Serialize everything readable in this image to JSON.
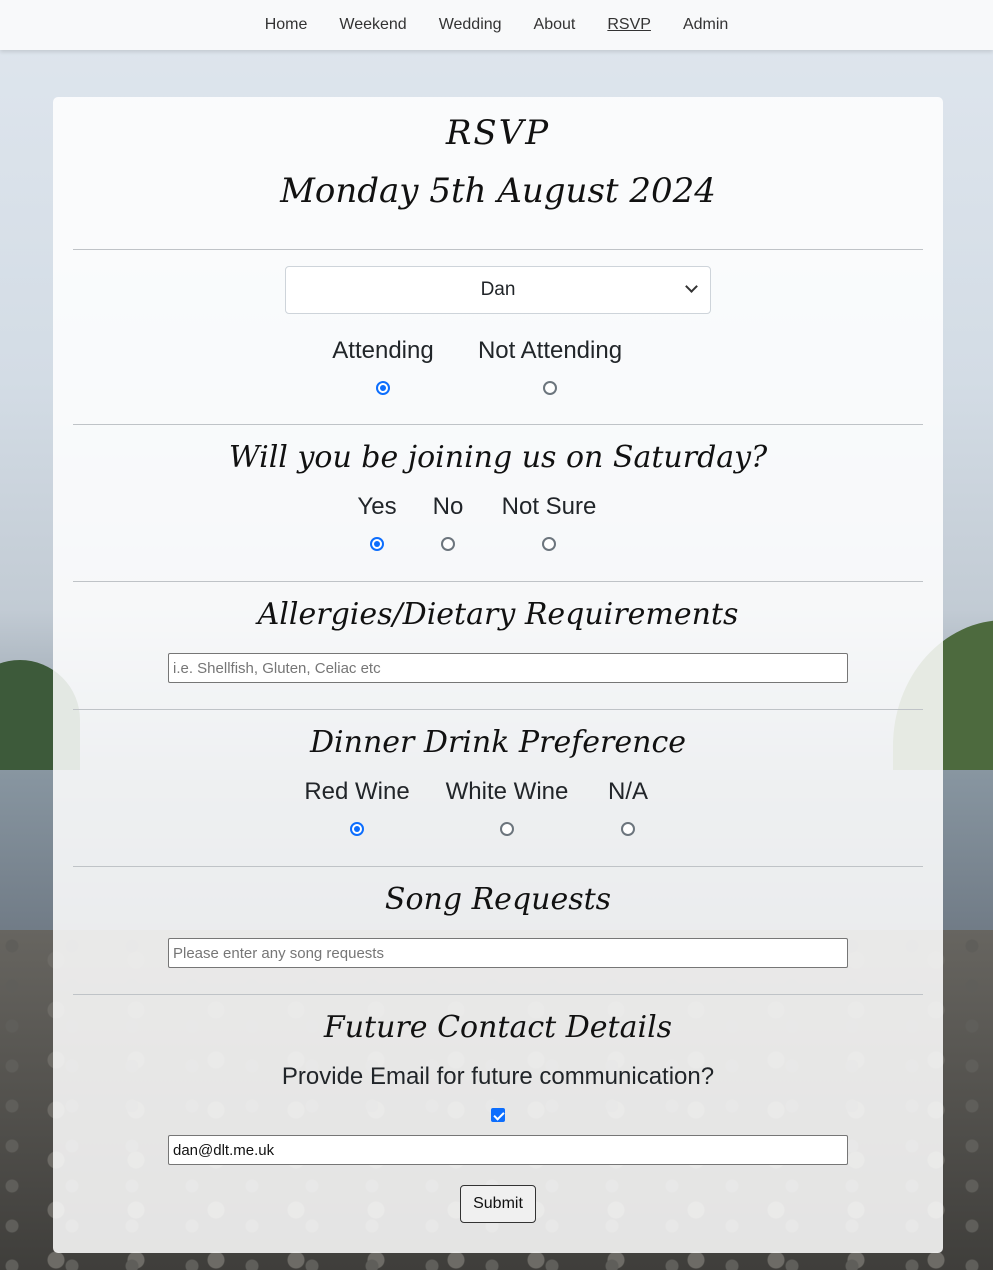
{
  "nav": {
    "items": [
      {
        "label": "Home"
      },
      {
        "label": "Weekend"
      },
      {
        "label": "Wedding"
      },
      {
        "label": "About"
      },
      {
        "label": "RSVP"
      },
      {
        "label": "Admin"
      }
    ],
    "active": "RSVP"
  },
  "header": {
    "title": "RSVP",
    "date": "Monday 5th August 2024"
  },
  "guest_select": {
    "selected": "Dan"
  },
  "attendance": {
    "options": [
      "Attending",
      "Not Attending"
    ],
    "selected": "Attending"
  },
  "saturday": {
    "heading": "Will you be joining us on Saturday?",
    "options": [
      "Yes",
      "No",
      "Not Sure"
    ],
    "selected": "Yes"
  },
  "allergies": {
    "heading": "Allergies/Dietary Requirements",
    "placeholder": "i.e. Shellfish, Gluten, Celiac etc",
    "value": ""
  },
  "drink": {
    "heading": "Dinner Drink Preference",
    "options": [
      "Red Wine",
      "White Wine",
      "N/A"
    ],
    "selected": "Red Wine"
  },
  "songs": {
    "heading": "Song Requests",
    "placeholder": "Please enter any song requests",
    "value": ""
  },
  "contact": {
    "heading": "Future Contact Details",
    "question": "Provide Email for future communication?",
    "checked": true,
    "email_value": "dan@dlt.me.uk"
  },
  "submit_label": "Submit",
  "colors": {
    "accent": "#0d6efd",
    "navbar_bg": "#f8f9fa"
  }
}
